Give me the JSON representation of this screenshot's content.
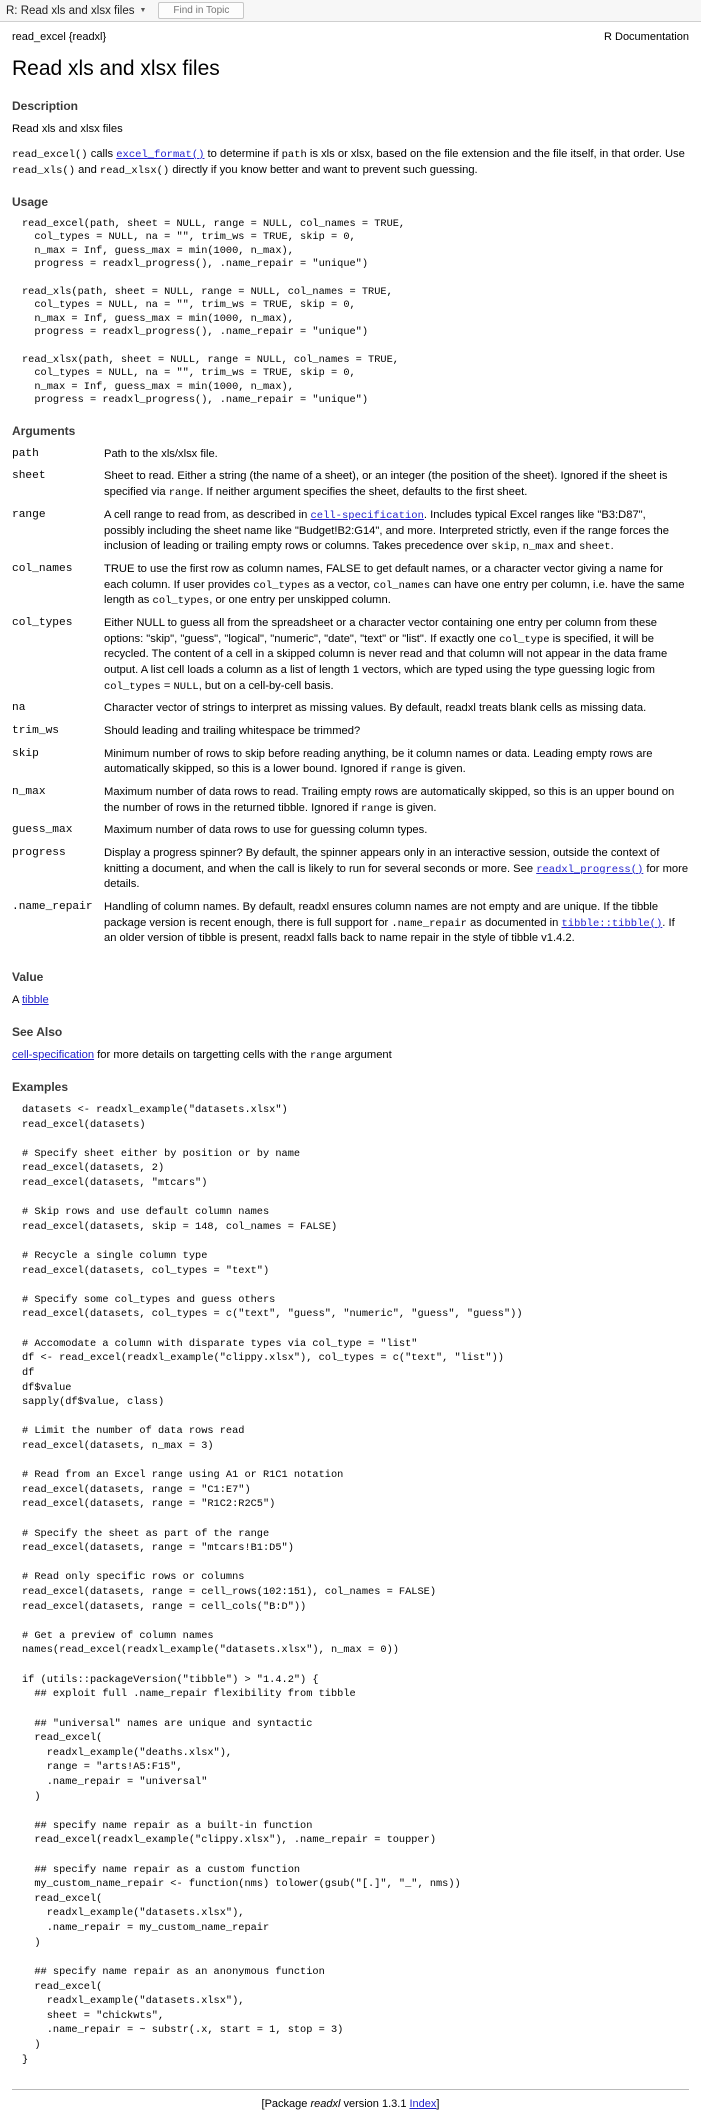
{
  "chrome": {
    "window_title": "R: Read xls and xlsx files",
    "caret_icon": "chevron-down-icon",
    "find_button": "Find in Topic"
  },
  "header": {
    "topic_id": "read_excel {readxl}",
    "doc_type": "R Documentation"
  },
  "title": "Read xls and xlsx files",
  "sections": {
    "description_heading": "Description",
    "usage_heading": "Usage",
    "arguments_heading": "Arguments",
    "value_heading": "Value",
    "see_also_heading": "See Also",
    "examples_heading": "Examples"
  },
  "description": {
    "p1": "Read xls and xlsx files",
    "p2_a": "read_excel()",
    "p2_b": " calls ",
    "p2_link": "excel_format()",
    "p2_c": " to determine if ",
    "p2_path": "path",
    "p2_d": " is xls or xlsx, based on the file extension and the file itself, in that order. Use ",
    "p2_xls": "read_xls()",
    "p2_e": " and ",
    "p2_xlsx": "read_xlsx()",
    "p2_f": " directly if you know better and want to prevent such guessing."
  },
  "usage_code": "read_excel(path, sheet = NULL, range = NULL, col_names = TRUE,\n  col_types = NULL, na = \"\", trim_ws = TRUE, skip = 0,\n  n_max = Inf, guess_max = min(1000, n_max),\n  progress = readxl_progress(), .name_repair = \"unique\")\n\nread_xls(path, sheet = NULL, range = NULL, col_names = TRUE,\n  col_types = NULL, na = \"\", trim_ws = TRUE, skip = 0,\n  n_max = Inf, guess_max = min(1000, n_max),\n  progress = readxl_progress(), .name_repair = \"unique\")\n\nread_xlsx(path, sheet = NULL, range = NULL, col_names = TRUE,\n  col_types = NULL, na = \"\", trim_ws = TRUE, skip = 0,\n  n_max = Inf, guess_max = min(1000, n_max),\n  progress = readxl_progress(), .name_repair = \"unique\")",
  "arguments": [
    {
      "name": "path",
      "desc_parts": [
        {
          "t": "Path to the xls/xlsx file.",
          "k": "text"
        }
      ]
    },
    {
      "name": "sheet",
      "desc_parts": [
        {
          "t": "Sheet to read. Either a string (the name of a sheet), or an integer (the position of the sheet). Ignored if the sheet is specified via ",
          "k": "text"
        },
        {
          "t": "range",
          "k": "code"
        },
        {
          "t": ". If neither argument specifies the sheet, defaults to the first sheet.",
          "k": "text"
        }
      ]
    },
    {
      "name": "range",
      "desc_parts": [
        {
          "t": "A cell range to read from, as described in ",
          "k": "text"
        },
        {
          "t": "cell-specification",
          "k": "link"
        },
        {
          "t": ". Includes typical Excel ranges like \"B3:D87\", possibly including the sheet name like \"Budget!B2:G14\", and more. Interpreted strictly, even if the range forces the inclusion of leading or trailing empty rows or columns. Takes precedence over ",
          "k": "text"
        },
        {
          "t": "skip",
          "k": "code"
        },
        {
          "t": ", ",
          "k": "text"
        },
        {
          "t": "n_max",
          "k": "code"
        },
        {
          "t": " and ",
          "k": "text"
        },
        {
          "t": "sheet",
          "k": "code"
        },
        {
          "t": ".",
          "k": "text"
        }
      ]
    },
    {
      "name": "col_names",
      "desc_parts": [
        {
          "t": "TRUE to use the first row as column names, FALSE to get default names, or a character vector giving a name for each column. If user provides ",
          "k": "text"
        },
        {
          "t": "col_types",
          "k": "code"
        },
        {
          "t": " as a vector, ",
          "k": "text"
        },
        {
          "t": "col_names",
          "k": "code"
        },
        {
          "t": " can have one entry per column, i.e. have the same length as ",
          "k": "text"
        },
        {
          "t": "col_types",
          "k": "code"
        },
        {
          "t": ", or one entry per unskipped column.",
          "k": "text"
        }
      ]
    },
    {
      "name": "col_types",
      "desc_parts": [
        {
          "t": "Either NULL to guess all from the spreadsheet or a character vector containing one entry per column from these options: \"skip\", \"guess\", \"logical\", \"numeric\", \"date\", \"text\" or \"list\". If exactly one ",
          "k": "text"
        },
        {
          "t": "col_type",
          "k": "code"
        },
        {
          "t": " is specified, it will be recycled. The content of a cell in a skipped column is never read and that column will not appear in the data frame output. A list cell loads a column as a list of length 1 vectors, which are typed using the type guessing logic from ",
          "k": "text"
        },
        {
          "t": "col_types",
          "k": "code"
        },
        {
          "t": " = ",
          "k": "text"
        },
        {
          "t": "NULL",
          "k": "code"
        },
        {
          "t": ", but on a cell-by-cell basis.",
          "k": "text"
        }
      ]
    },
    {
      "name": "na",
      "desc_parts": [
        {
          "t": "Character vector of strings to interpret as missing values. By default, readxl treats blank cells as missing data.",
          "k": "text"
        }
      ]
    },
    {
      "name": "trim_ws",
      "desc_parts": [
        {
          "t": "Should leading and trailing whitespace be trimmed?",
          "k": "text"
        }
      ]
    },
    {
      "name": "skip",
      "desc_parts": [
        {
          "t": "Minimum number of rows to skip before reading anything, be it column names or data. Leading empty rows are automatically skipped, so this is a lower bound. Ignored if ",
          "k": "text"
        },
        {
          "t": "range",
          "k": "code"
        },
        {
          "t": " is given.",
          "k": "text"
        }
      ]
    },
    {
      "name": "n_max",
      "desc_parts": [
        {
          "t": "Maximum number of data rows to read. Trailing empty rows are automatically skipped, so this is an upper bound on the number of rows in the returned tibble. Ignored if ",
          "k": "text"
        },
        {
          "t": "range",
          "k": "code"
        },
        {
          "t": " is given.",
          "k": "text"
        }
      ]
    },
    {
      "name": "guess_max",
      "desc_parts": [
        {
          "t": "Maximum number of data rows to use for guessing column types.",
          "k": "text"
        }
      ]
    },
    {
      "name": "progress",
      "desc_parts": [
        {
          "t": "Display a progress spinner? By default, the spinner appears only in an interactive session, outside the context of knitting a document, and when the call is likely to run for several seconds or more. See ",
          "k": "text"
        },
        {
          "t": "readxl_progress()",
          "k": "link"
        },
        {
          "t": " for more details.",
          "k": "text"
        }
      ]
    },
    {
      "name": ".name_repair",
      "desc_parts": [
        {
          "t": "Handling of column names. By default, readxl ensures column names are not empty and are unique. If the tibble package version is recent enough, there is full support for ",
          "k": "text"
        },
        {
          "t": ".name_repair",
          "k": "code"
        },
        {
          "t": " as documented in ",
          "k": "text"
        },
        {
          "t": "tibble::tibble()",
          "k": "link"
        },
        {
          "t": ". If an older version of tibble is present, readxl falls back to name repair in the style of tibble v1.4.2.",
          "k": "text"
        }
      ]
    }
  ],
  "value": {
    "prefix": "A ",
    "link": "tibble"
  },
  "see_also": {
    "link": "cell-specification",
    "mid": " for more details on targetting cells with the ",
    "code": "range",
    "suffix": " argument"
  },
  "examples_code": "datasets <- readxl_example(\"datasets.xlsx\")\nread_excel(datasets)\n\n# Specify sheet either by position or by name\nread_excel(datasets, 2)\nread_excel(datasets, \"mtcars\")\n\n# Skip rows and use default column names\nread_excel(datasets, skip = 148, col_names = FALSE)\n\n# Recycle a single column type\nread_excel(datasets, col_types = \"text\")\n\n# Specify some col_types and guess others\nread_excel(datasets, col_types = c(\"text\", \"guess\", \"numeric\", \"guess\", \"guess\"))\n\n# Accomodate a column with disparate types via col_type = \"list\"\ndf <- read_excel(readxl_example(\"clippy.xlsx\"), col_types = c(\"text\", \"list\"))\ndf\ndf$value\nsapply(df$value, class)\n\n# Limit the number of data rows read\nread_excel(datasets, n_max = 3)\n\n# Read from an Excel range using A1 or R1C1 notation\nread_excel(datasets, range = \"C1:E7\")\nread_excel(datasets, range = \"R1C2:R2C5\")\n\n# Specify the sheet as part of the range\nread_excel(datasets, range = \"mtcars!B1:D5\")\n\n# Read only specific rows or columns\nread_excel(datasets, range = cell_rows(102:151), col_names = FALSE)\nread_excel(datasets, range = cell_cols(\"B:D\"))\n\n# Get a preview of column names\nnames(read_excel(readxl_example(\"datasets.xlsx\"), n_max = 0))\n\nif (utils::packageVersion(\"tibble\") > \"1.4.2\") {\n  ## exploit full .name_repair flexibility from tibble\n\n  ## \"universal\" names are unique and syntactic\n  read_excel(\n    readxl_example(\"deaths.xlsx\"),\n    range = \"arts!A5:F15\",\n    .name_repair = \"universal\"\n  )\n\n  ## specify name repair as a built-in function\n  read_excel(readxl_example(\"clippy.xlsx\"), .name_repair = toupper)\n\n  ## specify name repair as a custom function\n  my_custom_name_repair <- function(nms) tolower(gsub(\"[.]\", \"_\", nms))\n  read_excel(\n    readxl_example(\"datasets.xlsx\"),\n    .name_repair = my_custom_name_repair\n  )\n\n  ## specify name repair as an anonymous function\n  read_excel(\n    readxl_example(\"datasets.xlsx\"),\n    sheet = \"chickwts\",\n    .name_repair = ~ substr(.x, start = 1, stop = 3)\n  )\n}",
  "footer": {
    "open": "[Package ",
    "package": "readxl",
    "version": " version 1.3.1 ",
    "index_link": "Index",
    "close": "]"
  }
}
